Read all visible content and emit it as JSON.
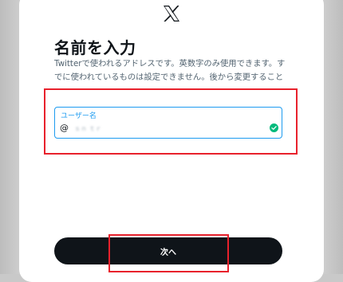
{
  "dialog": {
    "logo_icon": "x-logo-icon",
    "title": "名前を入力",
    "description": "Twitterで使われるアドレスです。英数字のみ使用できます。すでに使われているものは設定できません。後から変更することもできます。"
  },
  "username_field": {
    "label": "ユーザー名",
    "prefix": "@",
    "value": "ｓｎ ｔｒ",
    "status_icon": "check-circle-icon",
    "status_color": "#00ba7c",
    "focus_color": "#1d9bf0"
  },
  "actions": {
    "next_label": "次へ",
    "button_color": "#0f1419"
  },
  "annotations": {
    "highlight_color": "#e8212c"
  }
}
